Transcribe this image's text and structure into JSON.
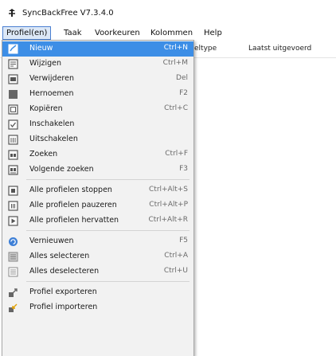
{
  "window": {
    "title": "SyncBackFree V7.3.4.0"
  },
  "menubar": {
    "items": [
      {
        "label": "Profiel(en)"
      },
      {
        "label": "Taak"
      },
      {
        "label": "Voorkeuren"
      },
      {
        "label": "Kolommen"
      },
      {
        "label": "Help"
      }
    ]
  },
  "list_header": {
    "col_type": "eltype",
    "col_last_run": "Laatst uitgevoerd"
  },
  "dropdown": {
    "items": [
      {
        "label": "Nieuw",
        "shortcut": "Ctrl+N",
        "icon": "new-profile-icon",
        "highlighted": true
      },
      {
        "label": "Wijzigen",
        "shortcut": "Ctrl+M",
        "icon": "edit-icon"
      },
      {
        "label": "Verwijderen",
        "shortcut": "Del",
        "icon": "delete-icon"
      },
      {
        "label": "Hernoemen",
        "shortcut": "F2",
        "icon": "rename-icon"
      },
      {
        "label": "Kopiëren",
        "shortcut": "Ctrl+C",
        "icon": "copy-icon"
      },
      {
        "label": "Inschakelen",
        "shortcut": "",
        "icon": "enable-icon"
      },
      {
        "label": "Uitschakelen",
        "shortcut": "",
        "icon": "disable-icon"
      },
      {
        "label": "Zoeken",
        "shortcut": "Ctrl+F",
        "icon": "search-icon"
      },
      {
        "label": "Volgende zoeken",
        "shortcut": "F3",
        "icon": "find-next-icon"
      },
      {
        "label": "Alle profielen stoppen",
        "shortcut": "Ctrl+Alt+S",
        "icon": "stop-all-icon"
      },
      {
        "label": "Alle profielen pauzeren",
        "shortcut": "Ctrl+Alt+P",
        "icon": "pause-all-icon"
      },
      {
        "label": "Alle profielen hervatten",
        "shortcut": "Ctrl+Alt+R",
        "icon": "resume-all-icon"
      },
      {
        "label": "Vernieuwen",
        "shortcut": "F5",
        "icon": "refresh-icon"
      },
      {
        "label": "Alles selecteren",
        "shortcut": "Ctrl+A",
        "icon": "select-all-icon"
      },
      {
        "label": "Alles deselecteren",
        "shortcut": "Ctrl+U",
        "icon": "deselect-all-icon"
      },
      {
        "label": "Profiel exporteren",
        "shortcut": "",
        "icon": "export-profile-icon"
      },
      {
        "label": "Profiel importeren",
        "shortcut": "",
        "icon": "import-profile-icon"
      }
    ]
  },
  "colors": {
    "highlight": "#3d8ee6",
    "menu_active_border": "#4a7fd1",
    "menu_active_bg": "#dce8f7"
  }
}
